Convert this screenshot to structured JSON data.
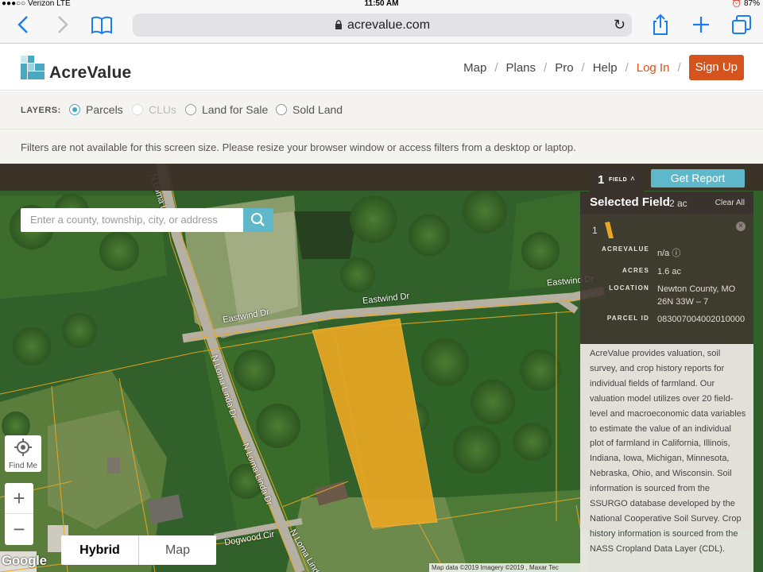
{
  "status": {
    "carrier": "●●●○○ Verizon  LTE",
    "time": "11:50 AM",
    "battery": "⏰ 87%"
  },
  "browser": {
    "url": "acrevalue.com"
  },
  "header": {
    "logo": "AcreValue",
    "nav": [
      "Map",
      "Plans",
      "Pro",
      "Help"
    ],
    "login": "Log In",
    "signup": "Sign Up"
  },
  "layers": {
    "title": "LAYERS:",
    "options": [
      {
        "label": "Parcels",
        "state": "selected"
      },
      {
        "label": "CLUs",
        "state": "disabled"
      },
      {
        "label": "Land for Sale",
        "state": "unselected"
      },
      {
        "label": "Sold Land",
        "state": "unselected"
      }
    ]
  },
  "filters_notice": "Filters are not available for this screen size. Please resize your browser window or access filters from a desktop or laptop.",
  "map": {
    "search_placeholder": "Enter a county, township, city, or address",
    "field_tab": {
      "count": "1",
      "label": "FIELD"
    },
    "get_report": "Get Report",
    "roads": [
      "Eastwind Dr",
      "Eastwind Dr",
      "Eastwind Dr",
      "N Loma Linda Dr",
      "N Loma Linda Dr",
      "N Loma Linda",
      "N Loma Linda",
      "Dogwood Cir"
    ],
    "find_me": "Find Me",
    "zoom_in": "+",
    "zoom_out": "−",
    "map_types": [
      "Hybrid",
      "Map"
    ],
    "google": "Google",
    "attribution": "Map data ©2019 Imagery ©2019 , Maxar Tec"
  },
  "panel": {
    "title": "Selected Field",
    "acres_summary": "2 ac",
    "clear_all": "Clear All",
    "field_number": "1",
    "rows": [
      {
        "key": "ACREVALUE",
        "value": "n/a ⓘ"
      },
      {
        "key": "ACRES",
        "value": "1.6 ac"
      },
      {
        "key": "LOCATION",
        "value": "Newton County, MO",
        "value2": "26N 33W – 7"
      },
      {
        "key": "PARCEL ID",
        "value": "083007004002010000"
      }
    ],
    "description": "AcreValue provides valuation, soil survey, and crop history reports for individual fields of farmland. Our valuation model utilizes over 20 field-level and macroeconomic data variables to estimate the value of an individual plot of farmland in California, Illinois, Indiana, Iowa, Michigan, Minnesota, Nebraska, Ohio, and Wisconsin. Soil information is sourced from the SSURGO database developed by the National Cooperative Soil Survey. Crop history information is sourced from the NASS Cropland Data Layer (CDL)."
  },
  "colors": {
    "brand_orange": "#d5531d",
    "accent_teal": "#5fb8c9",
    "parcel_fill": "#e8a623"
  }
}
